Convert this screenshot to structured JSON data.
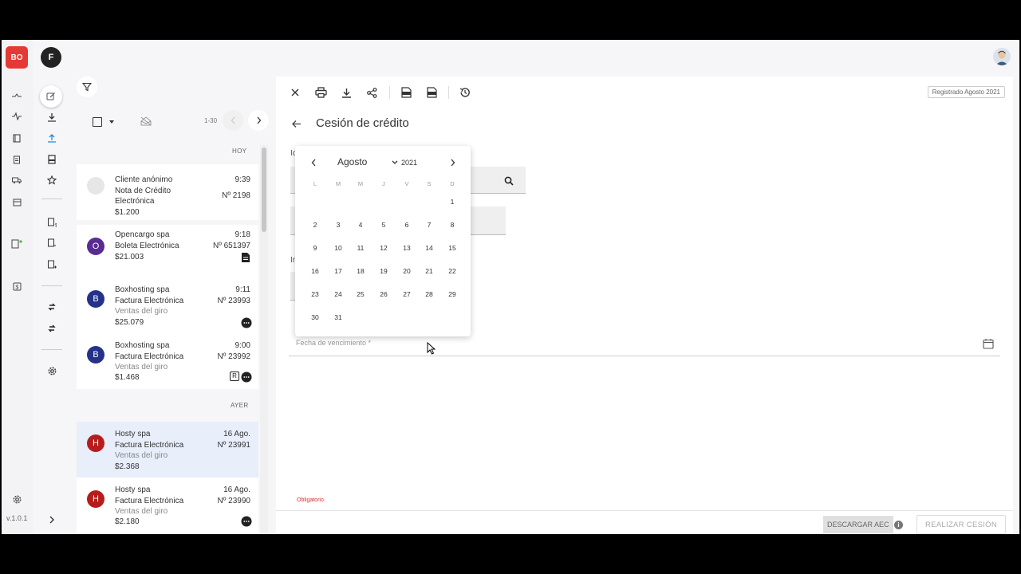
{
  "app": {
    "logo_text": "BO",
    "user_initial": "F",
    "version": "v.1.0.1",
    "brand_color": "#e53935"
  },
  "list": {
    "range_label": "1-30",
    "group_today": "HOY",
    "group_yesterday": "AYER",
    "items": [
      {
        "avatar": "",
        "avatar_color": "#e6e6e6",
        "name": "Cliente anónimo",
        "doc_type": "Nota de Crédito",
        "doc_type2": "Electrónica",
        "sub": "",
        "amount": "$1.200",
        "time": "9:39",
        "number": "Nº 2198",
        "badges": []
      },
      {
        "avatar": "O",
        "avatar_color": "#5a2b93",
        "name": "Opencargo spa",
        "doc_type": "Boleta Electrónica",
        "doc_type2": "",
        "sub": "",
        "amount": "$21.003",
        "time": "9:18",
        "number": "Nº 651397",
        "badges": [
          "document-icon"
        ]
      },
      {
        "avatar": "B",
        "avatar_color": "#24328a",
        "name": "Boxhosting spa",
        "doc_type": "Factura Electrónica",
        "doc_type2": "",
        "sub": "Ventas del giro",
        "amount": "$25.079",
        "time": "9:11",
        "number": "Nº 23993",
        "badges": [
          "chat-icon"
        ]
      },
      {
        "avatar": "B",
        "avatar_color": "#24328a",
        "name": "Boxhosting spa",
        "doc_type": "Factura Electrónica",
        "doc_type2": "",
        "sub": "Ventas del giro",
        "amount": "$1.468",
        "time": "9:00",
        "number": "Nº 23992",
        "badges": [
          "r-badge",
          "chat-icon"
        ],
        "badge_text": "R"
      },
      {
        "avatar": "H",
        "avatar_color": "#b71c1c",
        "name": "Hosty spa",
        "doc_type": "Factura Electrónica",
        "doc_type2": "",
        "sub": "Ventas del giro",
        "amount": "$2.368",
        "time": "16 Ago.",
        "number": "Nº 23991",
        "badges": [],
        "selected": true
      },
      {
        "avatar": "H",
        "avatar_color": "#b71c1c",
        "name": "Hosty spa",
        "doc_type": "Factura Electrónica",
        "doc_type2": "",
        "sub": "Ventas del giro",
        "amount": "$2.180",
        "time": "16 Ago.",
        "number": "Nº 23990",
        "badges": [
          "chat-icon"
        ]
      }
    ]
  },
  "panel": {
    "registered_badge": "Registrado Agosto 2021",
    "title": "Cesión de crédito",
    "due_date_placeholder": "Fecha de vencimiento *",
    "required_note": "Obligatorio.",
    "download_aec_label": "DESCARGAR AEC",
    "cession_button_label": "REALIZAR CESIÓN",
    "toolbar_icons": [
      "close-icon",
      "print-icon",
      "download-icon",
      "share-icon",
      "xml-icon",
      "ced-icon",
      "history-icon"
    ],
    "hidden_labels": {
      "field1": "Ic",
      "field3": "In"
    }
  },
  "calendar": {
    "month": "Agosto",
    "year": "2021",
    "weekdays": [
      "L",
      "M",
      "M",
      "J",
      "V",
      "S",
      "D"
    ],
    "first_weekday_index": 6,
    "days_in_month": 31
  }
}
